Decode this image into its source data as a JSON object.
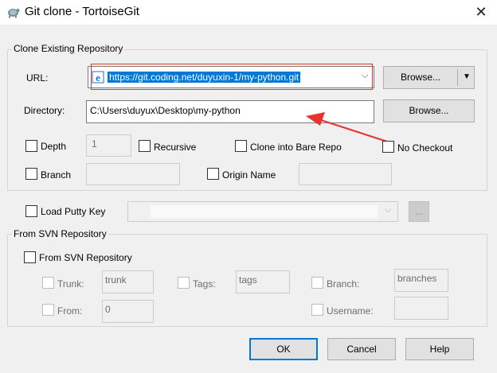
{
  "window": {
    "title": "Git clone - TortoiseGit",
    "close_glyph": "✕"
  },
  "clone": {
    "group_label": "Clone Existing Repository",
    "url_label": "URL:",
    "url_value": "https://git.coding.net/duyuxin-1/my-python.git",
    "browse_label": "Browse...",
    "directory_label": "Directory:",
    "directory_value": "C:\\Users\\duyux\\Desktop\\my-python",
    "browse2_label": "Browse...",
    "depth_label": "Depth",
    "depth_value": "1",
    "recursive_label": "Recursive",
    "bare_label": "Clone into Bare Repo",
    "nocheckout_label": "No Checkout",
    "branch_label": "Branch",
    "origin_label": "Origin Name"
  },
  "putty": {
    "label": "Load Putty Key",
    "ellipsis": "..."
  },
  "svn": {
    "group_label": "From SVN Repository",
    "checkbox_label": "From SVN Repository",
    "trunk_label": "Trunk:",
    "trunk_value": "trunk",
    "tags_label": "Tags:",
    "tags_value": "tags",
    "branch_label": "Branch:",
    "branch_value": "branches",
    "from_label": "From:",
    "from_value": "0",
    "username_label": "Username:"
  },
  "buttons": {
    "ok": "OK",
    "cancel": "Cancel",
    "help": "Help"
  },
  "colors": {
    "annotation_red": "#e8322d",
    "accent": "#0078d7"
  }
}
